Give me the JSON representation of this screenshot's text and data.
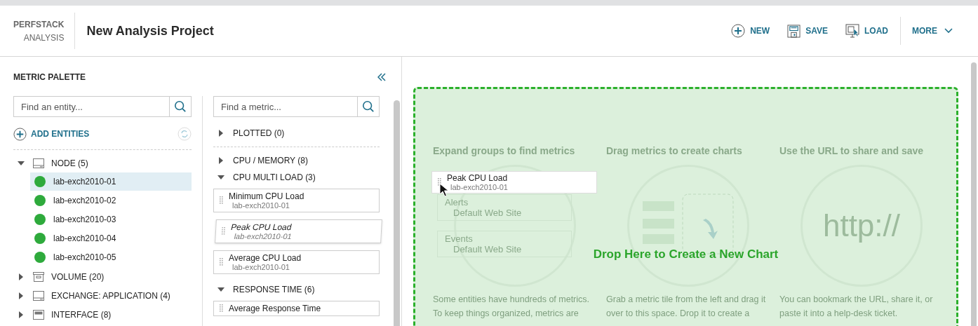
{
  "brand": {
    "line1": "PERFSTACK",
    "line2": "ANALYSIS"
  },
  "title": "New Analysis Project",
  "toolbar": [
    {
      "kind": "new",
      "label": "NEW"
    },
    {
      "kind": "save",
      "label": "SAVE"
    },
    {
      "kind": "load",
      "label": "LOAD"
    },
    {
      "kind": "more",
      "label": "MORE"
    }
  ],
  "palette": {
    "title": "METRIC PALETTE",
    "entity_search": {
      "placeholder": "Find an entity..."
    },
    "add_entities": "ADD ENTITIES",
    "entities": [
      {
        "kind": "node",
        "label": "NODE (5)",
        "expanded": true,
        "children": [
          {
            "label": "lab-exch2010-01",
            "color": "#2eaa3c",
            "selected": true
          },
          {
            "label": "lab-exch2010-02",
            "color": "#2eaa3c",
            "selected": false
          },
          {
            "label": "lab-exch2010-03",
            "color": "#2eaa3c",
            "selected": false
          },
          {
            "label": "lab-exch2010-04",
            "color": "#2eaa3c",
            "selected": false
          },
          {
            "label": "lab-exch2010-05",
            "color": "#2eaa3c",
            "selected": false
          }
        ]
      },
      {
        "kind": "volume",
        "label": "VOLUME (20)",
        "expanded": false
      },
      {
        "kind": "node",
        "label": "EXCHANGE: APPLICATION (4)",
        "expanded": false
      },
      {
        "kind": "interface",
        "label": "INTERFACE (8)",
        "expanded": false
      }
    ],
    "metric_search": {
      "placeholder": "Find a metric..."
    },
    "plotted": {
      "label": "PLOTTED (0)",
      "expanded": false
    },
    "groups": [
      {
        "label": "CPU / MEMORY (8)",
        "expanded": false
      },
      {
        "label": "CPU MULTI LOAD (3)",
        "expanded": true,
        "items": [
          {
            "name": "Minimum CPU Load",
            "entity": "lab-exch2010-01",
            "dragging": false
          },
          {
            "name": "Peak CPU Load",
            "entity": "lab-exch2010-01",
            "dragging": true
          },
          {
            "name": "Average CPU Load",
            "entity": "lab-exch2010-01",
            "dragging": false
          }
        ]
      },
      {
        "label": "RESPONSE TIME (6)",
        "expanded": true,
        "items": [
          {
            "name": "Average Response Time",
            "dragging": false
          }
        ]
      }
    ]
  },
  "drop_zone": {
    "message": "Drop Here to Create a New Chart",
    "tips": [
      {
        "kind": "tiles",
        "heading": "Expand groups to find metrics",
        "text": "Some entities have hundreds of metrics. To keep things organized, metrics are",
        "tiles": [
          {
            "name": "Alerts",
            "entity": "Default Web Site"
          },
          {
            "name": "Events",
            "entity": "Default Web Site"
          }
        ]
      },
      {
        "kind": "chart",
        "heading": "Drag metrics to create charts",
        "text": "Grab a metric tile from the left and drag it over to this space. Drop it to create a"
      },
      {
        "kind": "url",
        "heading": "Use the URL to share and save",
        "text": "You can bookmark the URL, share it, or paste it into a help-desk ticket.",
        "url": "http://"
      }
    ],
    "drag_tile": {
      "name": "Peak CPU Load",
      "entity": "lab-exch2010-01"
    }
  }
}
